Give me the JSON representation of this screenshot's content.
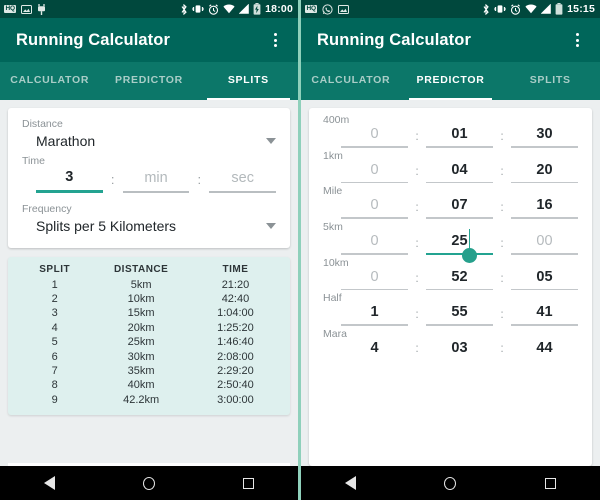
{
  "left": {
    "statusbar": {
      "icons_left": [
        "hq-badge-icon",
        "screenshot-icon",
        "usb-plug-icon"
      ],
      "hq_label": "HQ",
      "icons_right": [
        "bluetooth-icon",
        "vibrate-icon",
        "alarm-icon",
        "wifi-icon",
        "signal-icon",
        "battery-charging-icon"
      ],
      "time": "18:00"
    },
    "appbar": {
      "title": "Running Calculator",
      "overflow": "more-options"
    },
    "tabs": [
      {
        "label": "CALCULATOR",
        "active": false
      },
      {
        "label": "PREDICTOR",
        "active": false
      },
      {
        "label": "SPLITS",
        "active": true
      }
    ],
    "form": {
      "distance_label": "Distance",
      "distance_value": "Marathon",
      "time_label": "Time",
      "time_hours": "3",
      "time_min_placeholder": "min",
      "time_sec_placeholder": "sec",
      "frequency_label": "Frequency",
      "frequency_value": "Splits per 5 Kilometers"
    },
    "splits_table": {
      "headers": [
        "SPLIT",
        "DISTANCE",
        "TIME"
      ],
      "rows": [
        [
          "1",
          "5km",
          "21:20"
        ],
        [
          "2",
          "10km",
          "42:40"
        ],
        [
          "3",
          "15km",
          "1:04:00"
        ],
        [
          "4",
          "20km",
          "1:25:20"
        ],
        [
          "5",
          "25km",
          "1:46:40"
        ],
        [
          "6",
          "30km",
          "2:08:00"
        ],
        [
          "7",
          "35km",
          "2:29:20"
        ],
        [
          "8",
          "40km",
          "2:50:40"
        ],
        [
          "9",
          "42.2km",
          "3:00:00"
        ]
      ]
    },
    "navbar": [
      "back-icon",
      "home-icon",
      "recents-icon"
    ]
  },
  "right": {
    "statusbar": {
      "icons_left": [
        "hq-badge-icon",
        "whatsapp-icon",
        "screenshot-icon"
      ],
      "hq_label": "HQ",
      "icons_right": [
        "bluetooth-icon",
        "vibrate-icon",
        "alarm-icon",
        "wifi-icon",
        "signal-icon",
        "battery-icon"
      ],
      "time": "15:15"
    },
    "appbar": {
      "title": "Running Calculator",
      "overflow": "more-options"
    },
    "tabs": [
      {
        "label": "CALCULATOR",
        "active": false
      },
      {
        "label": "PREDICTOR",
        "active": true
      },
      {
        "label": "SPLITS",
        "active": false
      }
    ],
    "predictor_rows": [
      {
        "label": "400m",
        "h": "0",
        "m": "01",
        "s": "30",
        "h_placeholder": true,
        "focused": false
      },
      {
        "label": "1km",
        "h": "0",
        "m": "04",
        "s": "20",
        "h_placeholder": true,
        "focused": false
      },
      {
        "label": "Mile",
        "h": "0",
        "m": "07",
        "s": "16",
        "h_placeholder": true,
        "focused": false
      },
      {
        "label": "5km",
        "h": "0",
        "m": "25",
        "s": "00",
        "h_placeholder": true,
        "s_placeholder": true,
        "focused": true
      },
      {
        "label": "10km",
        "h": "0",
        "m": "52",
        "s": "05",
        "h_placeholder": true,
        "focused": false
      },
      {
        "label": "Half",
        "h": "1",
        "m": "55",
        "s": "41",
        "h_placeholder": false,
        "focused": false
      },
      {
        "label": "Mara",
        "h": "4",
        "m": "03",
        "s": "44",
        "h_placeholder": false,
        "focused": false
      }
    ],
    "colon": ":",
    "navbar": [
      "back-icon",
      "home-icon",
      "recents-icon"
    ]
  },
  "colors": {
    "statusbar": "#00483d",
    "appbar": "#00665a",
    "tabbar": "#0c7769",
    "accent": "#23a391",
    "body": "#eceff0",
    "splits_bg": "#def0ee",
    "divider": "#8fd0bb"
  }
}
